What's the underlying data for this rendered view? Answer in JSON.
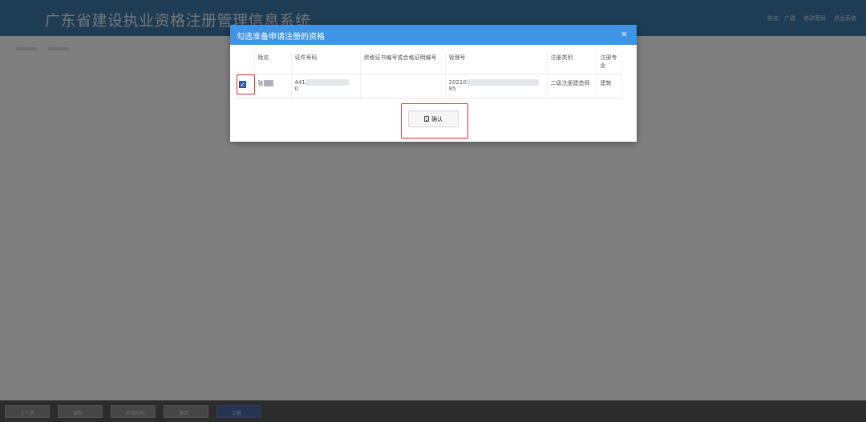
{
  "app": {
    "title": "广东省建设执业资格注册管理信息系统",
    "header_links": [
      "姓名：广建",
      "修改密码",
      "退出系统"
    ]
  },
  "footer": {
    "buttons": [
      "上一步",
      "保存",
      "申请材料",
      "撤回",
      "上报"
    ]
  },
  "modal": {
    "title": "勾选准备申请注册的资格",
    "close_glyph": "×",
    "columns": [
      "",
      "姓名",
      "证件号码",
      "资格证书编号或合格证明编号",
      "管理号",
      "注册类别",
      "注册专业"
    ],
    "rows": [
      {
        "checked": true,
        "name_prefix": "张",
        "id_number_prefix": "441",
        "id_number_suffix": "0",
        "certificate_number": "",
        "management_prefix": "20210",
        "management_suffix": "95",
        "registration_category": "二级注册建造师",
        "registration_specialty": "建筑"
      }
    ],
    "confirm_label": "确认"
  },
  "colors": {
    "header_bg": "#3d78a8",
    "modal_header_bg": "#3f94e6",
    "checkbox": "#3864b4",
    "highlight": "#e0312e"
  },
  "icons": [
    "close-icon",
    "document-icon",
    "checkbox-checked-icon"
  ]
}
